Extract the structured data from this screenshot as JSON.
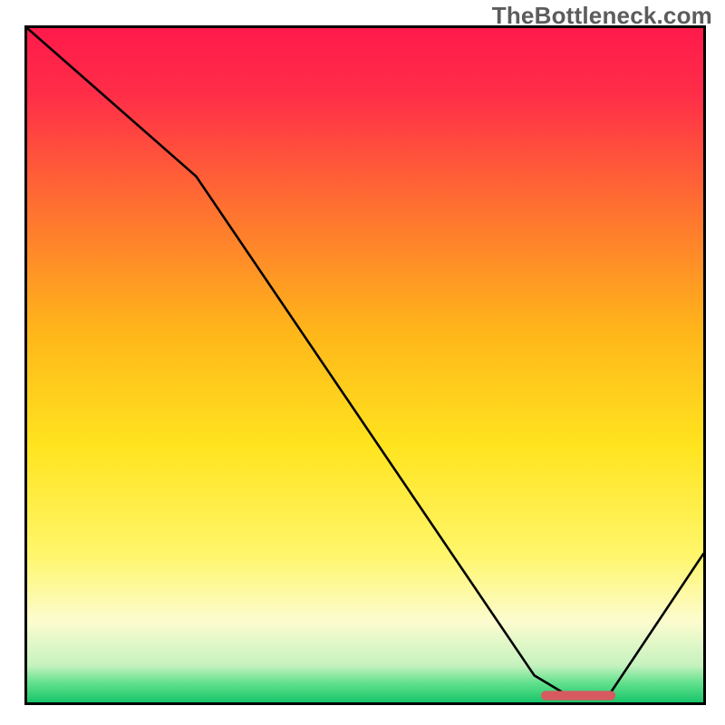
{
  "watermark": "TheBottleneck.com",
  "chart_data": {
    "type": "line",
    "title": "",
    "xlabel": "",
    "ylabel": "",
    "xlim": [
      0,
      100
    ],
    "ylim": [
      0,
      100
    ],
    "grid": false,
    "legend": false,
    "background_gradient_stops": [
      {
        "offset": 0.0,
        "color": "#ff1a4b"
      },
      {
        "offset": 0.1,
        "color": "#ff2e48"
      },
      {
        "offset": 0.25,
        "color": "#ff6a33"
      },
      {
        "offset": 0.45,
        "color": "#ffb61a"
      },
      {
        "offset": 0.62,
        "color": "#ffe41f"
      },
      {
        "offset": 0.78,
        "color": "#fff66a"
      },
      {
        "offset": 0.88,
        "color": "#fcfccf"
      },
      {
        "offset": 0.945,
        "color": "#c6f2bf"
      },
      {
        "offset": 0.972,
        "color": "#5fe08b"
      },
      {
        "offset": 1.0,
        "color": "#18c56b"
      }
    ],
    "series": [
      {
        "name": "bottleneck-curve",
        "x": [
          0,
          25,
          75,
          80,
          86,
          100
        ],
        "y": [
          100,
          78,
          4,
          1,
          1,
          22
        ]
      }
    ],
    "marker": {
      "shape": "rounded-bar",
      "color": "#d65a5f",
      "x_start": 76,
      "x_end": 87,
      "y": 1,
      "thickness_pct": 1.4
    },
    "annotations": []
  }
}
